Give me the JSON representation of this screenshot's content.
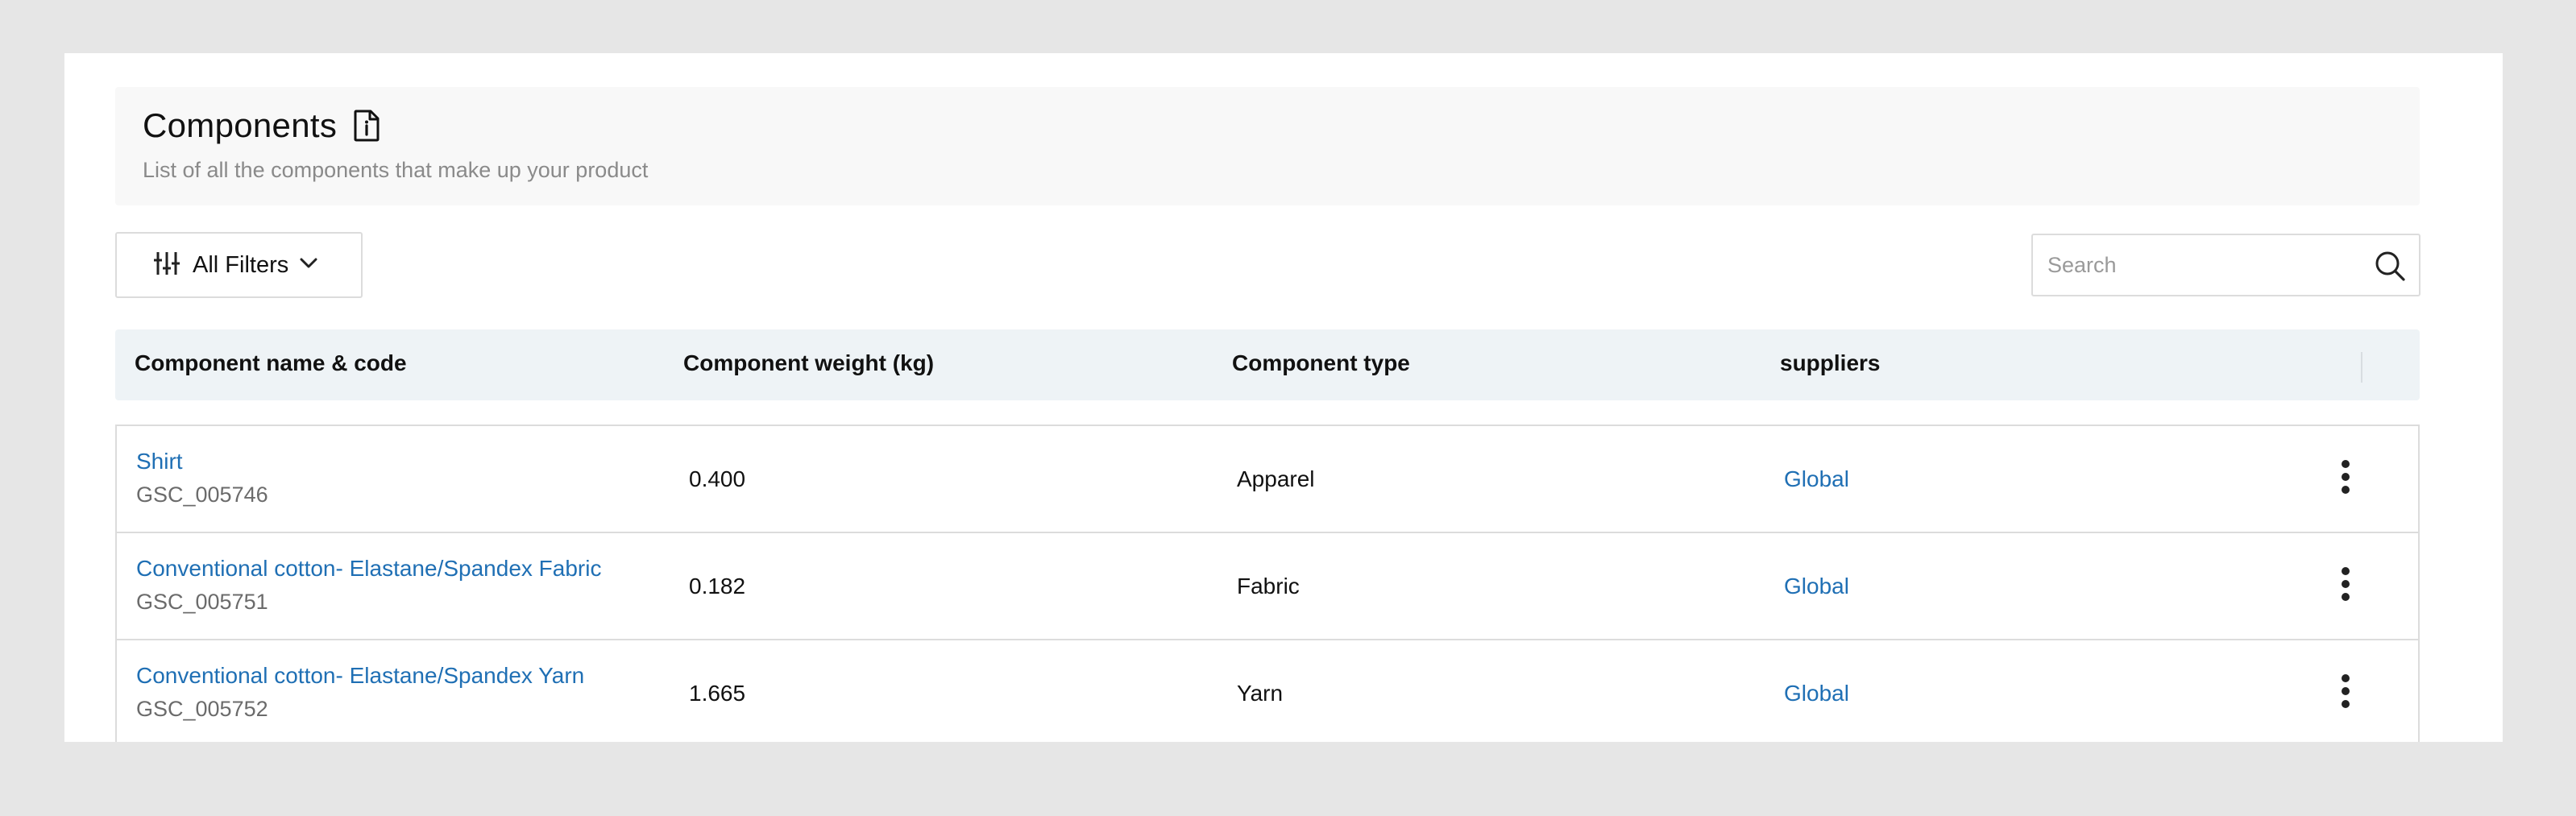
{
  "header": {
    "title": "Components",
    "subtitle": "List of all the components that make up your product",
    "title_icon": "document-info-icon"
  },
  "toolbar": {
    "filters_label": "All Filters",
    "filters_icon": "sliders-icon",
    "search_placeholder": "Search",
    "search_value": ""
  },
  "table": {
    "columns": [
      "Component name & code",
      "Component weight (kg)",
      "Component type",
      "suppliers"
    ],
    "rows": [
      {
        "name": "Shirt",
        "code": "GSC_005746",
        "weight": "0.400",
        "type": "Apparel",
        "supplier": "Global"
      },
      {
        "name": "Conventional cotton- Elastane/Spandex Fabric",
        "code": "GSC_005751",
        "weight": "0.182",
        "type": "Fabric",
        "supplier": "Global"
      },
      {
        "name": "Conventional cotton- Elastane/Spandex Yarn",
        "code": "GSC_005752",
        "weight": "1.665",
        "type": "Yarn",
        "supplier": "Global"
      }
    ]
  },
  "colors": {
    "link": "#1f6fb4",
    "header_bg": "#eef3f6",
    "panel_bg": "#f8f8f8",
    "page_bg": "#e6e6e6"
  }
}
